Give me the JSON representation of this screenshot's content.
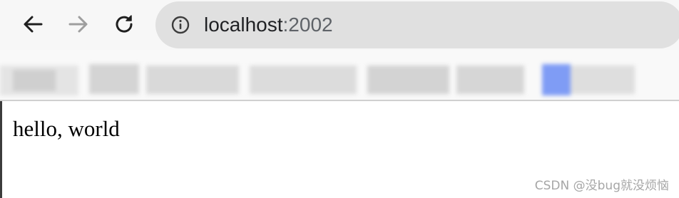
{
  "browser": {
    "url_host": "localhost",
    "url_sep": ":",
    "url_port": "2002"
  },
  "page": {
    "body_text": "hello, world"
  },
  "watermark": {
    "text": "CSDN @没bug就没烦恼"
  },
  "colors": {
    "toolbar_bg": "#f7f7f7",
    "omnibox_bg": "#e0e0e0",
    "url_text": "#202124",
    "disabled_icon": "#9e9e9e",
    "bookmark_accent": "#7f9cf5"
  },
  "icons": {
    "back": "arrow-left-icon",
    "forward": "arrow-right-icon",
    "reload": "reload-icon",
    "site_info": "info-icon"
  }
}
